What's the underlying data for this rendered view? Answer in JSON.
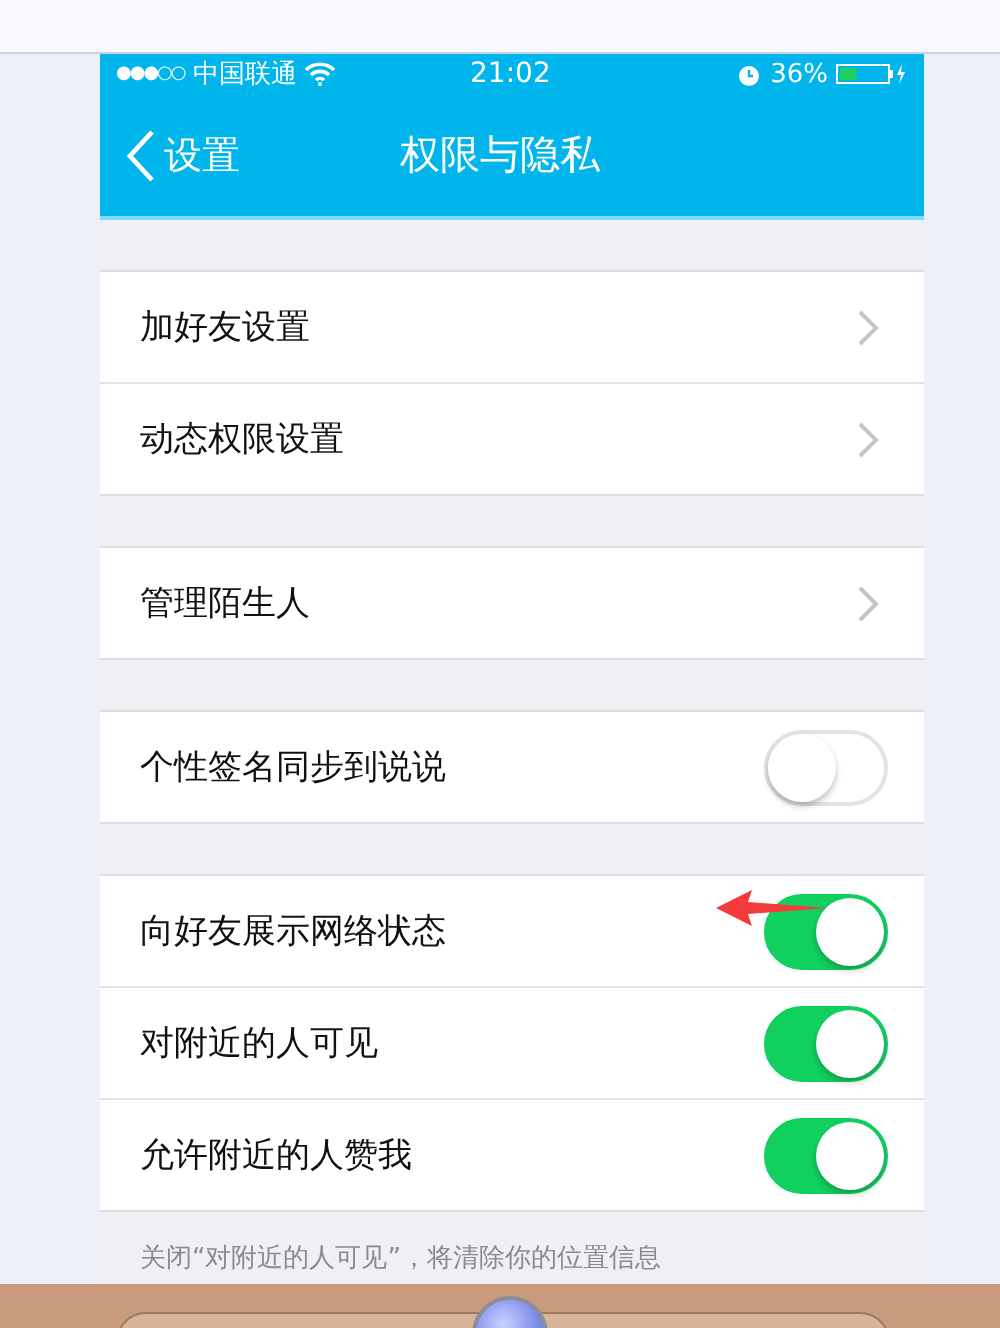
{
  "status_bar": {
    "signal_dots": "●●●○○",
    "carrier": "中国联通",
    "time": "21:02",
    "battery": "36%",
    "battery_meter": {
      "level": 0.36
    }
  },
  "nav": {
    "back": "设置",
    "title": "权限与隐私"
  },
  "groups": [
    {
      "rows": [
        {
          "label": "加好友设置",
          "kind": "chevron"
        },
        {
          "label": "动态权限设置",
          "kind": "chevron"
        }
      ]
    },
    {
      "rows": [
        {
          "label": "管理陌生人",
          "kind": "chevron"
        }
      ]
    },
    {
      "rows": [
        {
          "label": "个性签名同步到说说",
          "kind": "toggle",
          "on": false
        }
      ]
    },
    {
      "rows": [
        {
          "label": "向好友展示网络状态",
          "kind": "toggle",
          "on": true
        },
        {
          "label": "对附近的人可见",
          "kind": "toggle",
          "on": true
        },
        {
          "label": "允许附近的人赞我",
          "kind": "toggle",
          "on": true
        }
      ]
    }
  ],
  "footer_note": "关闭“对附近的人可见”，将清除你的位置信息"
}
